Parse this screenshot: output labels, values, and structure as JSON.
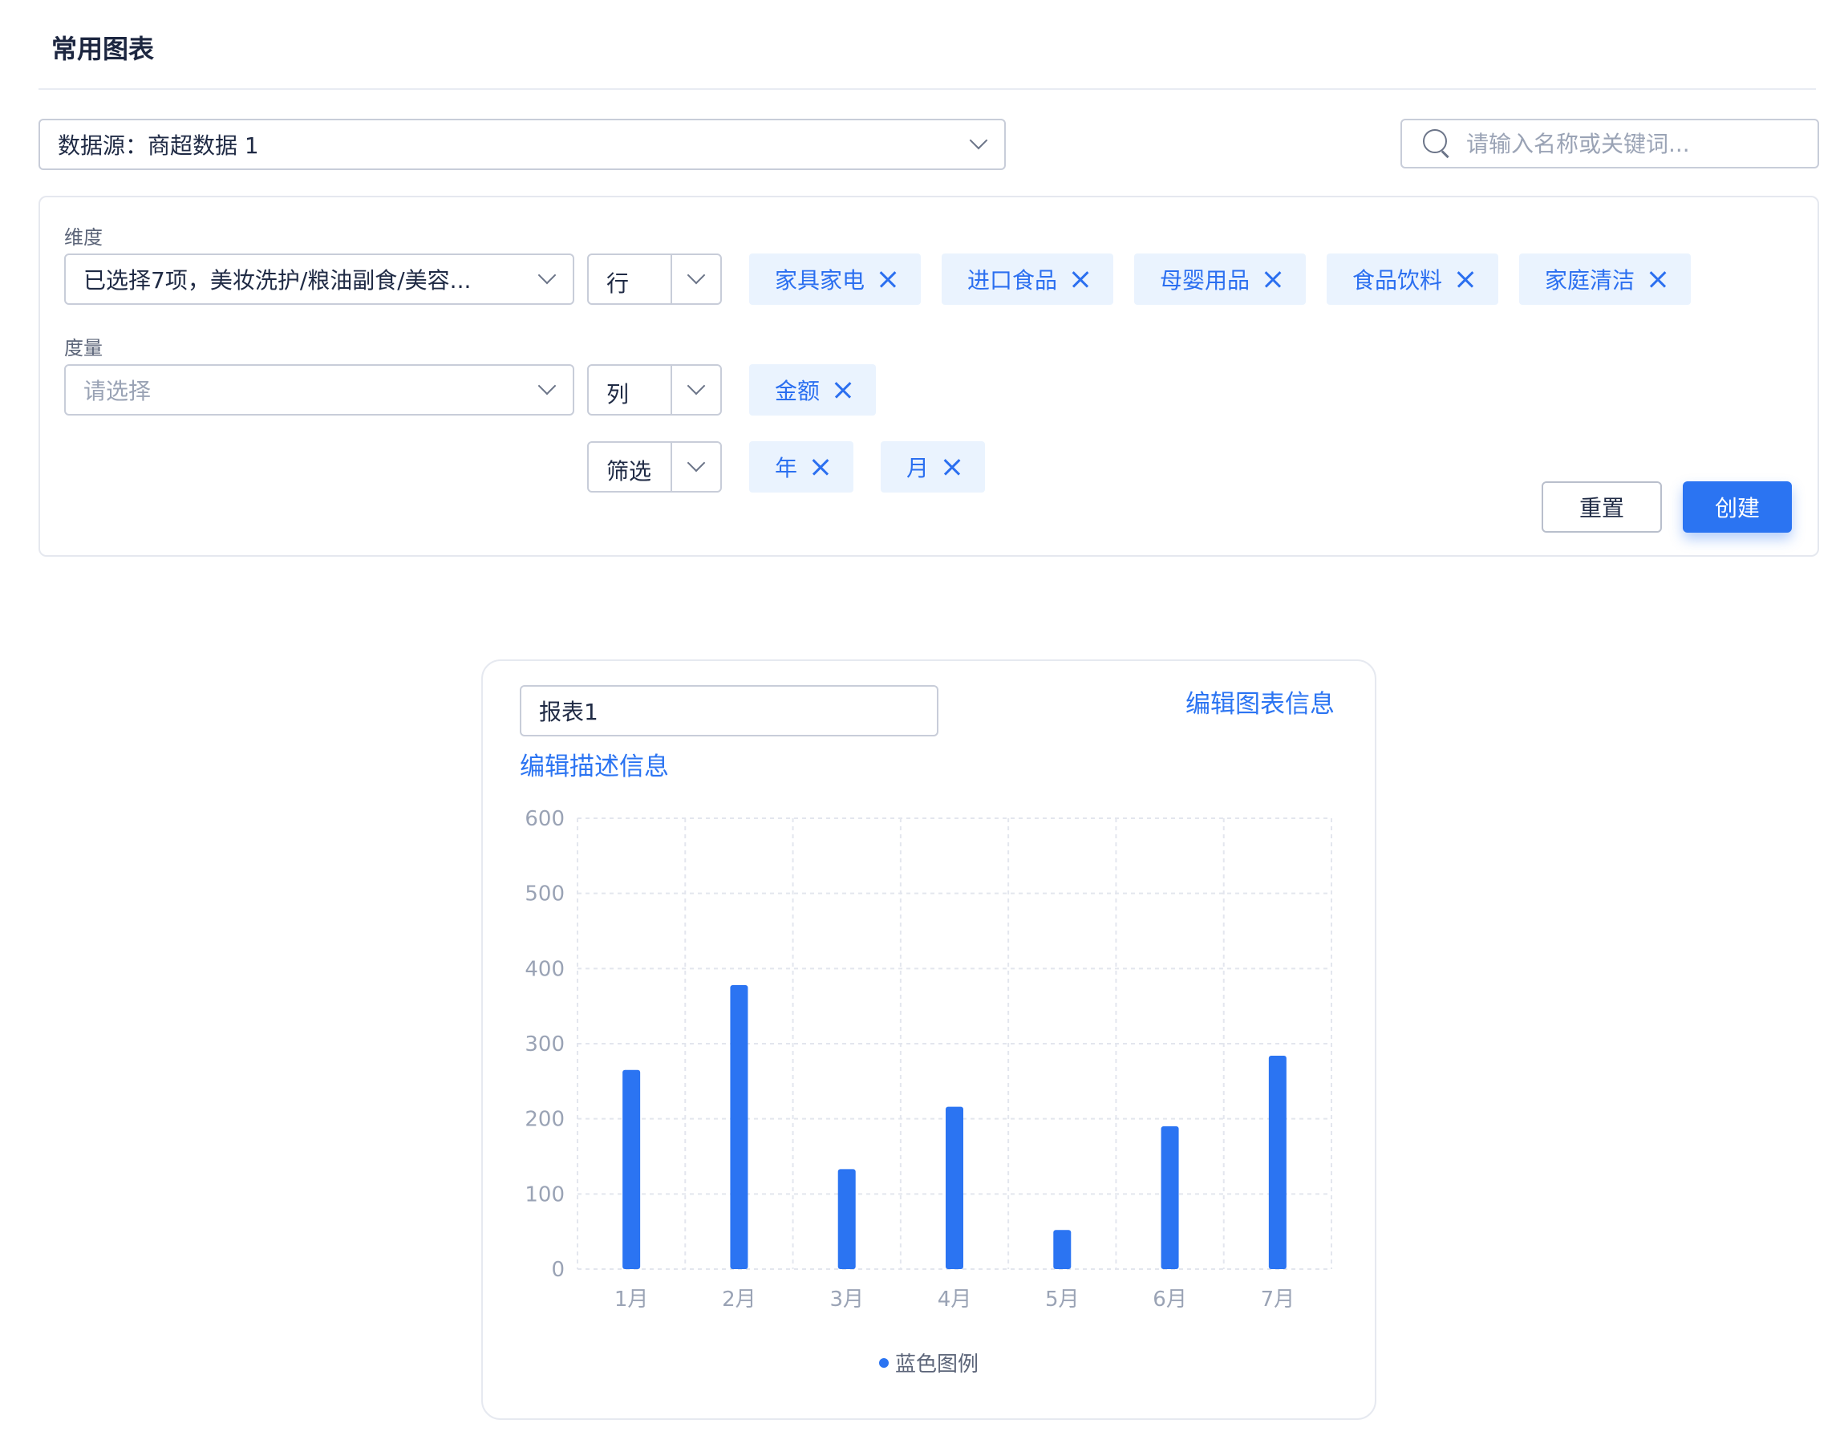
{
  "page": {
    "title": "常用图表"
  },
  "datasource": {
    "label": "数据源：商超数据 1"
  },
  "search": {
    "placeholder": "请输入名称或关键词..."
  },
  "dimension": {
    "label": "维度",
    "value": "已选择7项，美妆洗护/粮油副食/美容...",
    "type": "行",
    "tags": [
      "家具家电",
      "进口食品",
      "母婴用品",
      "食品饮料",
      "家庭清洁"
    ]
  },
  "measure": {
    "label": "度量",
    "placeholder": "请选择",
    "type": "列",
    "tags": [
      "金额"
    ]
  },
  "filter": {
    "type": "筛选",
    "tags": [
      "年",
      "月"
    ]
  },
  "actions": {
    "reset": "重置",
    "create": "创建"
  },
  "chart_card": {
    "name": "报表1",
    "edit_chart_link": "编辑图表信息",
    "edit_desc_link": "编辑描述信息"
  },
  "colors": {
    "accent": "#2b74f2",
    "tag_bg": "#eaf3fe"
  },
  "chart_data": {
    "type": "bar",
    "categories": [
      "1月",
      "2月",
      "3月",
      "4月",
      "5月",
      "6月",
      "7月"
    ],
    "series": [
      {
        "name": "蓝色图例",
        "values": [
          265,
          378,
          133,
          216,
          52,
          190,
          284
        ]
      }
    ],
    "yticks": [
      0,
      100,
      200,
      300,
      400,
      500,
      600
    ],
    "ylim": [
      0,
      600
    ],
    "grid": true,
    "legend": "bottom"
  }
}
